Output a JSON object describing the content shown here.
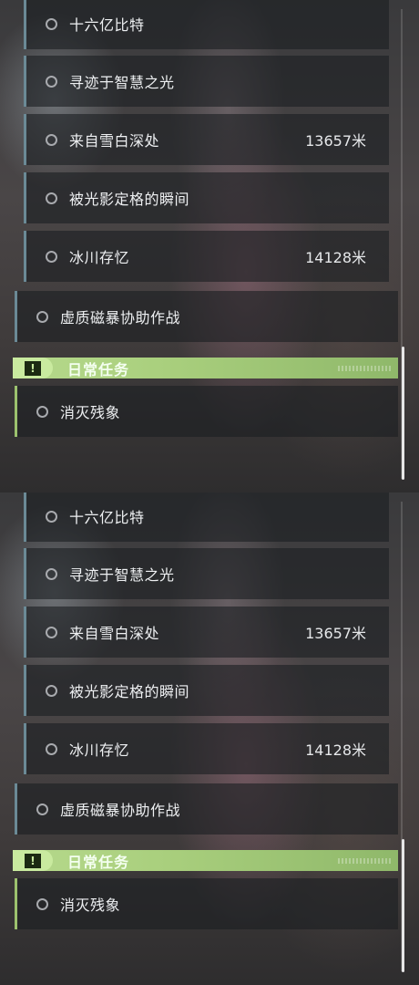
{
  "panels": [
    {
      "side_quests": [
        {
          "label": "十六亿比特",
          "distance": ""
        },
        {
          "label": "寻迹于智慧之光",
          "distance": ""
        },
        {
          "label": "来自雪白深处",
          "distance": "13657米"
        },
        {
          "label": "被光影定格的瞬间",
          "distance": ""
        },
        {
          "label": "冰川存忆",
          "distance": "14128米"
        }
      ],
      "main_quest": {
        "label": "虚质磁暴协助作战"
      },
      "daily_header": {
        "title": "日常任务",
        "icon": "!"
      },
      "daily_quests": [
        {
          "label": "消灭残象"
        }
      ]
    },
    {
      "side_quests": [
        {
          "label": "十六亿比特",
          "distance": ""
        },
        {
          "label": "寻迹于智慧之光",
          "distance": ""
        },
        {
          "label": "来自雪白深处",
          "distance": "13657米"
        },
        {
          "label": "被光影定格的瞬间",
          "distance": ""
        },
        {
          "label": "冰川存忆",
          "distance": "14128米"
        }
      ],
      "main_quest": {
        "label": "虚质磁暴协助作战"
      },
      "daily_header": {
        "title": "日常任务",
        "icon": "!"
      },
      "daily_quests": [
        {
          "label": "消灭残象"
        }
      ]
    }
  ],
  "colors": {
    "accent_daily": "#a9cf7d",
    "accent_side": "#6b8a96"
  }
}
